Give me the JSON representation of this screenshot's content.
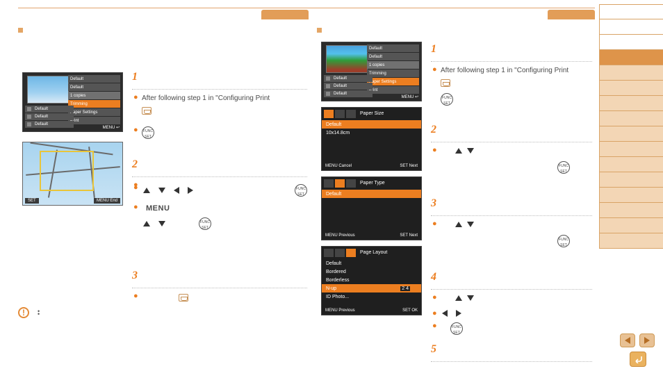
{
  "left": {
    "section_title": " ",
    "step1": {
      "num": "1",
      "title": " ",
      "line1": "After following step 1 in \"Configuring Print"
    },
    "step2": {
      "num": "2",
      "title": " "
    },
    "step3": {
      "num": "3",
      "title": " "
    },
    "menu_label": "MENU",
    "lcd1": {
      "menu": [
        "Default",
        "Default",
        "1 copies",
        "Trimming",
        "Paper Settings",
        "Print"
      ],
      "side": [
        "Default",
        "Default",
        "Default"
      ],
      "foot_right": "MENU ↩"
    },
    "crop": {
      "set": "SET",
      "menu_end": "MENU End"
    },
    "warn": {
      "items": [
        " ",
        " "
      ]
    }
  },
  "right": {
    "section_title": " ",
    "step1": {
      "num": "1",
      "title": " ",
      "line1": "After following step 1 in \"Configuring Print"
    },
    "step2": {
      "num": "2",
      "title": " "
    },
    "step3": {
      "num": "3",
      "title": " "
    },
    "step4": {
      "num": "4",
      "title": " "
    },
    "step5": {
      "num": "5",
      "title": " "
    },
    "lcd1": {
      "menu": [
        "Default",
        "Default",
        "1 copies",
        "Trimming",
        "Paper Settings",
        "Print"
      ],
      "side": [
        "Default",
        "Default",
        "Default"
      ],
      "foot_right": "MENU ↩"
    },
    "paper_size": {
      "title": "Paper Size",
      "opts": [
        "Default",
        "10x14.8cm"
      ],
      "cancel": "MENU Cancel",
      "next": "SET Next"
    },
    "paper_type": {
      "title": "Paper Type",
      "opts": [
        "Default"
      ],
      "prev": "MENU Previous",
      "next": "SET Next"
    },
    "page_layout": {
      "title": "Page Layout",
      "opts": [
        "Default",
        "Bordered",
        "Borderless",
        "N-up",
        "ID Photo..."
      ],
      "nup_count": "2 4",
      "prev": "MENU Previous",
      "ok": "SET OK"
    }
  },
  "funcset": "FUNC\nSET",
  "sidebar": {
    "cells": 16,
    "highlighted": 3
  }
}
